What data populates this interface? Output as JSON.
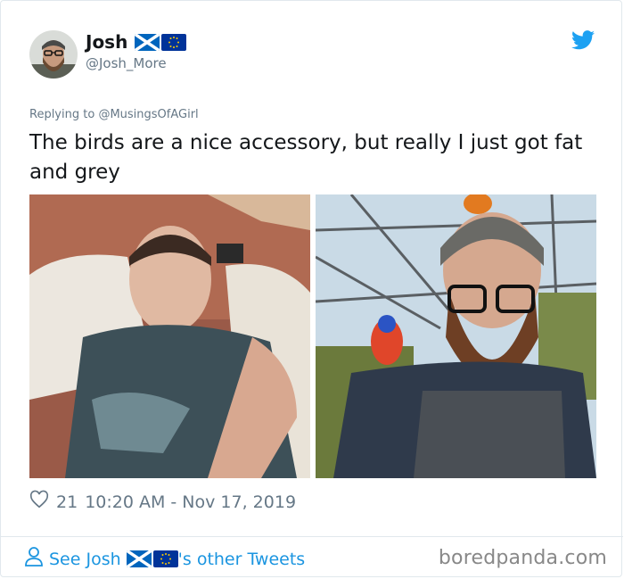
{
  "author": {
    "display_name": "Josh",
    "handle": "@Josh_More",
    "flags": [
      "scotland-flag-icon",
      "eu-flag-icon"
    ]
  },
  "reply": {
    "prefix": "Replying to ",
    "to": "@MusingsOfAGirl"
  },
  "tweet": {
    "text": "The birds are a nice accessory, but really I just got fat and grey"
  },
  "stats": {
    "likes": "21",
    "timestamp": "10:20 AM - Nov 17, 2019"
  },
  "footer": {
    "see_prefix": "See Josh",
    "see_suffix": "'s other Tweets",
    "brand": "boredpanda.com"
  },
  "colors": {
    "twitter_blue": "#1da1f2",
    "link_blue": "#1b95e0",
    "muted_gray": "#657786"
  }
}
